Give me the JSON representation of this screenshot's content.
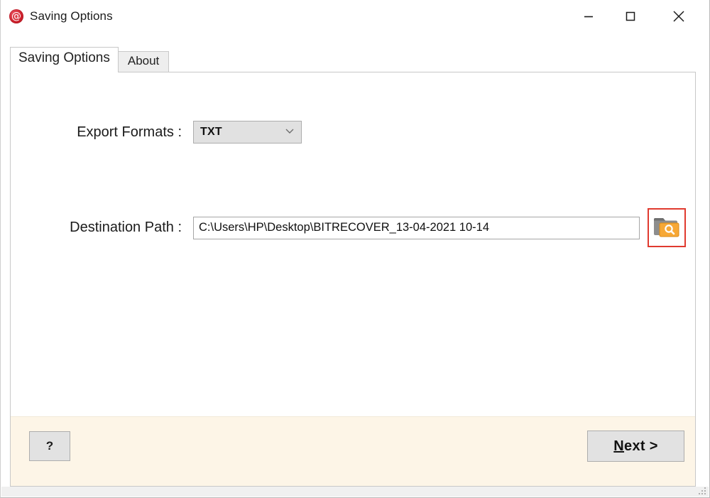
{
  "window": {
    "title": "Saving Options",
    "icon": "at-sign-icon",
    "controls": {
      "minimize": "minimize-icon",
      "maximize": "maximize-icon",
      "close": "close-icon"
    }
  },
  "tabs": [
    {
      "label": "Saving Options",
      "active": true
    },
    {
      "label": "About",
      "active": false
    }
  ],
  "form": {
    "export_formats": {
      "label": "Export Formats :",
      "value": "TXT",
      "options": [
        "TXT"
      ],
      "chevron": "chevron-down-icon"
    },
    "destination_path": {
      "label": "Destination Path :",
      "value": "C:\\Users\\HP\\Desktop\\BITRECOVER_13-04-2021 10-14",
      "placeholder": "",
      "browse_icon": "folder-search-icon"
    }
  },
  "footer": {
    "help_label": "?",
    "next_label_prefix": "N",
    "next_label_rest": "ext >"
  },
  "colors": {
    "accent_red": "#e03a2f",
    "footer_bg": "#fdf5e7",
    "button_bg": "#e2e2e2",
    "title_icon_red": "#d0242f",
    "folder_orange": "#f7a836"
  }
}
